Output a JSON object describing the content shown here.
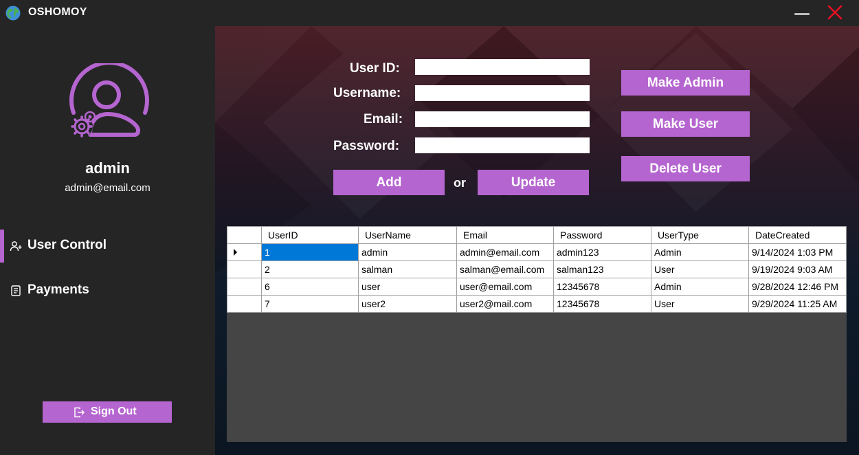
{
  "window": {
    "title": "OSHOMOY",
    "logo_icon": "globe-icon",
    "minimize_icon": "minimize-icon",
    "close_icon": "close-icon"
  },
  "sidebar": {
    "avatar_icon": "admin-user-gear-icon",
    "profile_name": "admin",
    "profile_email": "admin@email.com",
    "nav": [
      {
        "label": "User Control",
        "icon": "users-icon",
        "active": true
      },
      {
        "label": "Payments",
        "icon": "receipt-icon",
        "active": false
      }
    ],
    "signout_label": "Sign Out",
    "signout_icon": "sign-out-icon"
  },
  "form": {
    "userid_label": "User ID:",
    "username_label": "Username:",
    "email_label": "Email:",
    "password_label": "Password:",
    "userid_value": "",
    "username_value": "",
    "email_value": "",
    "password_value": "",
    "add_label": "Add",
    "or_label": "or",
    "update_label": "Update"
  },
  "actions": {
    "make_admin_label": "Make Admin",
    "make_user_label": "Make User",
    "delete_user_label": "Delete User"
  },
  "table": {
    "columns": [
      "UserID",
      "UserName",
      "Email",
      "Password",
      "UserType",
      "DateCreated"
    ],
    "rows": [
      [
        "1",
        "admin",
        "admin@email.com",
        "admin123",
        "Admin",
        "9/14/2024 1:03 PM"
      ],
      [
        "2",
        "salman",
        "salman@email.com",
        "salman123",
        "User",
        "9/19/2024 9:03 AM"
      ],
      [
        "6",
        "user",
        "user@email.com",
        "12345678",
        "Admin",
        "9/28/2024 12:46 PM"
      ],
      [
        "7",
        "user2",
        "user2@mail.com",
        "12345678",
        "User",
        "9/29/2024 11:25 AM"
      ]
    ],
    "selected_row": 0
  },
  "colors": {
    "accent": "#b565cf",
    "background": "#252526",
    "selection": "#0078d7",
    "close": "#e81123"
  }
}
